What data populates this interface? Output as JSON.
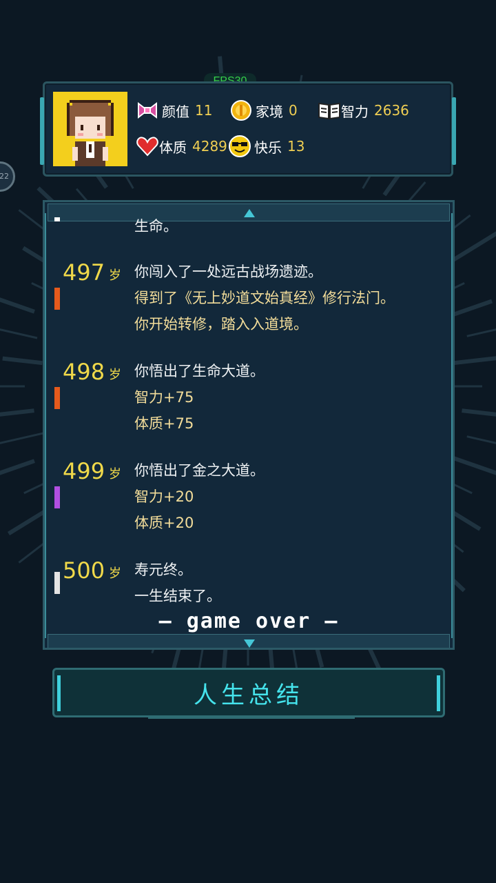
{
  "hud": {
    "fps": "FPS30",
    "side_bubble": "22"
  },
  "stats": [
    {
      "name": "颜值",
      "value": "11",
      "icon": "bow-icon",
      "color": "#d94fa2"
    },
    {
      "name": "家境",
      "value": "0",
      "icon": "coin-icon",
      "color": "#f2b40f"
    },
    {
      "name": "智力",
      "value": "2636",
      "icon": "book-icon",
      "color": "#ffffff"
    },
    {
      "name": "体质",
      "value": "4289",
      "icon": "heart-icon",
      "color": "#e02d2d"
    },
    {
      "name": "快乐",
      "value": "13",
      "icon": "sunglasses-smiley-icon",
      "color": "#f2c80f"
    }
  ],
  "timeline": {
    "partial_top": "生命。",
    "entries": [
      {
        "age": "497",
        "unit": "岁",
        "marker": "#e55a1c",
        "lines": [
          {
            "text": "你闯入了一处远古战场遗迹。",
            "tone": "white"
          },
          {
            "text": "得到了《无上妙道文始真经》修行法门。",
            "tone": "gold"
          },
          {
            "text": "你开始转修，踏入入道境。",
            "tone": "gold"
          }
        ]
      },
      {
        "age": "498",
        "unit": "岁",
        "marker": "#e55a1c",
        "lines": [
          {
            "text": "你悟出了生命大道。",
            "tone": "white"
          },
          {
            "text": "智力+75",
            "tone": "gold"
          },
          {
            "text": "体质+75",
            "tone": "gold"
          }
        ]
      },
      {
        "age": "499",
        "unit": "岁",
        "marker": "#b14fe0",
        "lines": [
          {
            "text": "你悟出了金之大道。",
            "tone": "white"
          },
          {
            "text": "智力+20",
            "tone": "gold"
          },
          {
            "text": "体质+20",
            "tone": "gold"
          }
        ]
      },
      {
        "age": "500",
        "unit": "岁",
        "marker": "#e4e4e4",
        "lines": [
          {
            "text": "寿元终。",
            "tone": "white"
          },
          {
            "text": "一生结束了。",
            "tone": "white"
          }
        ]
      }
    ],
    "game_over": "— game over —"
  },
  "buttons": {
    "summary": "人生总结"
  }
}
